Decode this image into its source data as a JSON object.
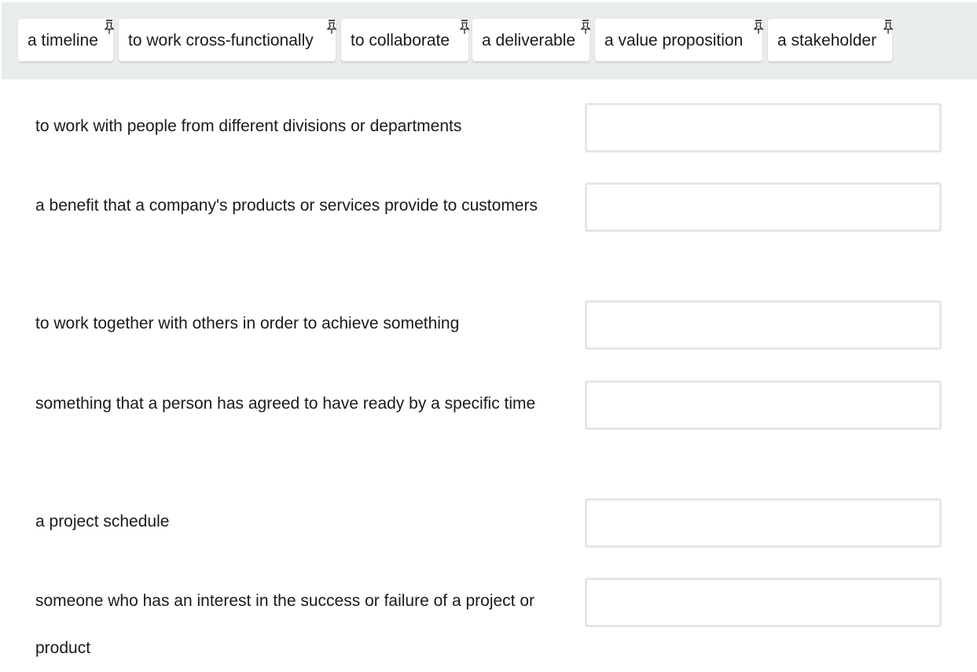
{
  "word_bank": {
    "chips": [
      {
        "label": "a timeline",
        "icon": "pin-icon"
      },
      {
        "label": "to work cross-functionally",
        "icon": "pin-icon"
      },
      {
        "label": "to collaborate",
        "icon": "pin-icon"
      },
      {
        "label": "a deliverable",
        "icon": "pin-icon"
      },
      {
        "label": "a value proposition",
        "icon": "pin-icon"
      },
      {
        "label": "a stakeholder",
        "icon": "pin-icon"
      }
    ]
  },
  "definitions": [
    {
      "text": "to work with people from different divisions or departments",
      "answer": ""
    },
    {
      "text": "a benefit that a company's products or services provide to customers",
      "answer": ""
    },
    {
      "text": "to work together with others in order to achieve something",
      "answer": ""
    },
    {
      "text": "something that a person has agreed to have ready by a specific time",
      "answer": ""
    },
    {
      "text": "a project schedule",
      "answer": ""
    },
    {
      "text": "someone who has an interest in the success or failure of a project or product",
      "answer": ""
    }
  ],
  "colors": {
    "bank_background": "#e9ecec",
    "drop_border": "#e6e6e6"
  }
}
